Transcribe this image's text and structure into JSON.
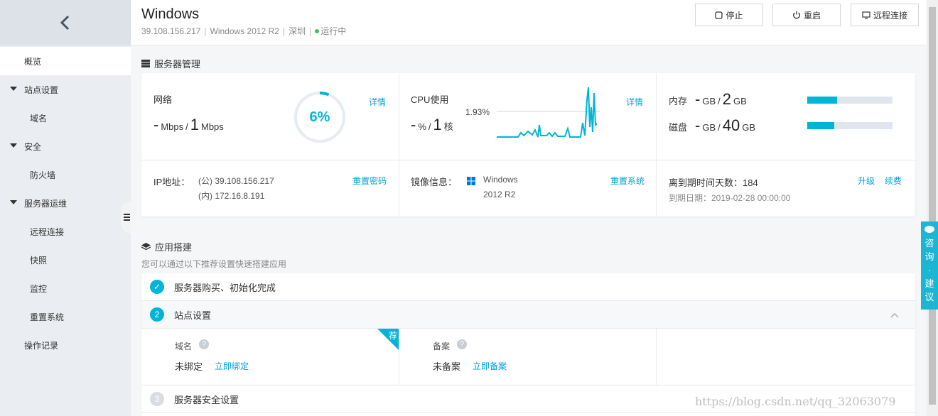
{
  "header": {
    "title": "Windows",
    "ip": "39.108.156.217",
    "os": "Windows 2012 R2",
    "region": "深圳",
    "status": "运行中",
    "buttons": {
      "stop": "停止",
      "restart": "重启",
      "remote": "远程连接"
    }
  },
  "sidebar": {
    "items": [
      {
        "label": "概览"
      },
      {
        "label": "站点设置"
      },
      {
        "label": "域名"
      },
      {
        "label": "安全"
      },
      {
        "label": "防火墙"
      },
      {
        "label": "服务器运维"
      },
      {
        "label": "远程连接"
      },
      {
        "label": "快照"
      },
      {
        "label": "监控"
      },
      {
        "label": "重置系统"
      },
      {
        "label": "操作记录"
      }
    ]
  },
  "server": {
    "section_title": "服务器管理",
    "network": {
      "label": "网络",
      "used": "-",
      "used_unit": "Mbps",
      "sep": "/",
      "total": "1",
      "total_unit": "Mbps",
      "percent_text": "6%",
      "percent": 6,
      "detail": "详情"
    },
    "cpu": {
      "label": "CPU使用",
      "used": "-",
      "used_unit": "%",
      "sep": "/",
      "cores": "1",
      "cores_unit": "核",
      "peak": "1.93%",
      "detail": "详情"
    },
    "memory": {
      "label": "内存",
      "used": "-",
      "used_unit": "GB",
      "sep": "/",
      "total": "2",
      "total_unit": "GB",
      "fill": 0.35
    },
    "disk": {
      "label": "磁盘",
      "used": "-",
      "used_unit": "GB",
      "sep": "/",
      "total": "40",
      "total_unit": "GB",
      "fill": 0.32
    },
    "ip": {
      "label": "IP地址：",
      "public": "(公) 39.108.156.217",
      "private": "(内) 172.16.8.191",
      "action": "重置密码"
    },
    "image": {
      "label": "镜像信息：",
      "name_line1": "Windows",
      "name_line2": "2012 R2",
      "action": "重置系统"
    },
    "expire": {
      "days_text": "离到期时间天数：184",
      "date_text": "到期日期：2019-02-28 00:00:00",
      "upgrade": "升级",
      "renew": "续费"
    }
  },
  "apps": {
    "section_title": "应用搭建",
    "subtitle": "您可以通过以下推荐设置快速搭建应用",
    "step1": {
      "label": "服务器购买、初始化完成"
    },
    "step2": {
      "number": "2",
      "label": "站点设置"
    },
    "domain": {
      "label": "域名",
      "status": "未绑定",
      "action": "立即绑定",
      "badge": "荐"
    },
    "beian": {
      "label": "备案",
      "status": "未备案",
      "action": "立即备案"
    },
    "step3": {
      "number": "3",
      "label": "服务器安全设置"
    }
  },
  "consult": {
    "chars": [
      "咨",
      "询",
      "·",
      "建",
      "议"
    ]
  },
  "watermark": "https://blog.csdn.net/qq_32063079",
  "colors": {
    "accent": "#00b5d6",
    "link": "#00a2d9",
    "status_green": "#42c25f",
    "sidebar_bg": "#eaedf1"
  }
}
